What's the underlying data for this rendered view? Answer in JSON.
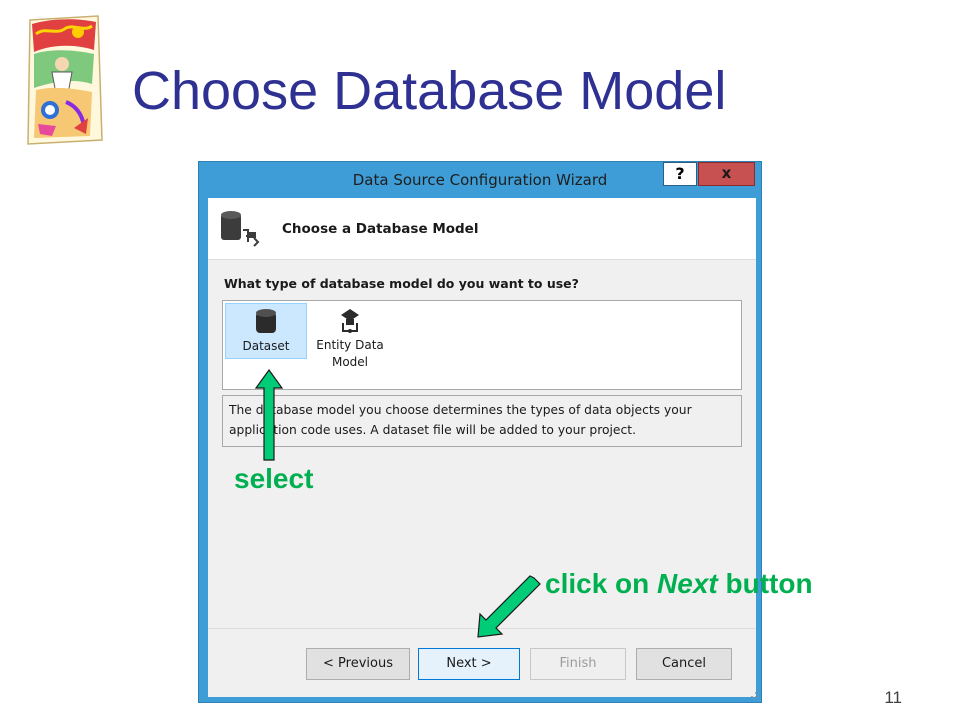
{
  "slide": {
    "title": "Choose Database Model",
    "page_number": "11"
  },
  "window": {
    "title": "Data Source Configuration Wizard",
    "help_label": "?",
    "close_label": "x"
  },
  "header": {
    "title": "Choose a Database Model",
    "icon": "database-connection-icon"
  },
  "question": "What type of database model do you want to use?",
  "options": [
    {
      "label": "Dataset",
      "icon": "database-icon",
      "selected": true
    },
    {
      "label_line1": "Entity Data",
      "label_line2": "Model",
      "icon": "entity-model-icon",
      "selected": false
    }
  ],
  "description": {
    "line1": "The database model you choose determines the types of data objects your",
    "line2": "application code uses. A dataset file will be added to your project."
  },
  "buttons": {
    "previous": "< Previous",
    "next": "Next >",
    "finish": "Finish",
    "cancel": "Cancel"
  },
  "annotations": {
    "select": "select",
    "click_prefix": "click on ",
    "click_emphasis": "Next",
    "click_suffix": " button",
    "color": "#00b050"
  },
  "colors": {
    "title": "#2e3192",
    "window_frame": "#3e9dd6",
    "close_button": "#c75050",
    "arrow_fill": "#00cc77"
  }
}
